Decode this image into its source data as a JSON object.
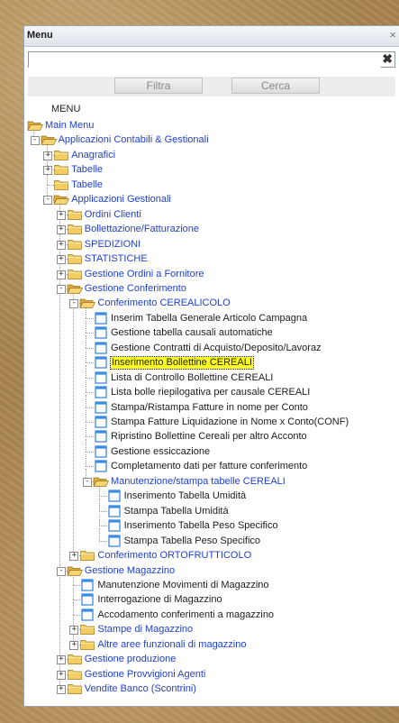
{
  "window": {
    "title": "Menu",
    "close_glyph": "×"
  },
  "search": {
    "value": "",
    "placeholder": "",
    "clear_glyph": "✖"
  },
  "buttons": {
    "filtra": "Filtra",
    "cerca": "Cerca"
  },
  "tree_caption": "MENU",
  "colors": {
    "folder": "#f0c75a",
    "link": "#1f3fd1",
    "highlight": "#ffff1e",
    "leaf_icon": "#3b82d6"
  },
  "tree": [
    {
      "label": "Main Menu",
      "level": 0,
      "icon": "folder-open",
      "exp": "",
      "blue": true
    },
    {
      "label": "Applicazioni Contabili & Gestionali",
      "level": 1,
      "icon": "folder-open",
      "exp": "-",
      "blue": true
    },
    {
      "label": "Anagrafici",
      "level": 2,
      "icon": "folder",
      "exp": "+",
      "blue": true
    },
    {
      "label": "Tabelle",
      "level": 2,
      "icon": "folder",
      "exp": "+",
      "blue": true
    },
    {
      "label": "Tabelle",
      "level": 2,
      "icon": "folder",
      "exp": "",
      "blue": true
    },
    {
      "label": "Applicazioni Gestionali",
      "level": 2,
      "icon": "folder-open",
      "exp": "-",
      "blue": true
    },
    {
      "label": "Ordini Clienti",
      "level": 3,
      "icon": "folder",
      "exp": "+",
      "blue": true
    },
    {
      "label": "Bollettazione/Fatturazione",
      "level": 3,
      "icon": "folder",
      "exp": "+",
      "blue": true
    },
    {
      "label": "SPEDIZIONI",
      "level": 3,
      "icon": "folder",
      "exp": "+",
      "blue": true
    },
    {
      "label": "STATISTICHE",
      "level": 3,
      "icon": "folder",
      "exp": "+",
      "blue": true
    },
    {
      "label": "Gestione Ordini a Fornitore",
      "level": 3,
      "icon": "folder",
      "exp": "+",
      "blue": true
    },
    {
      "label": "Gestione Conferimento",
      "level": 3,
      "icon": "folder-open",
      "exp": "-",
      "blue": true
    },
    {
      "label": "Conferimento CEREALICOLO",
      "level": 4,
      "icon": "folder-open",
      "exp": "-",
      "blue": true
    },
    {
      "label": "Inserim Tabella Generale Articolo Campagna",
      "level": 5,
      "icon": "program",
      "exp": "",
      "blue": false
    },
    {
      "label": "Gestione tabella causali automatiche",
      "level": 5,
      "icon": "program",
      "exp": "",
      "blue": false
    },
    {
      "label": "Gestione Contratti di Acquisto/Deposito/Lavoraz",
      "level": 5,
      "icon": "program",
      "exp": "",
      "blue": false
    },
    {
      "label": "Inserimento Bollettine CEREALI",
      "level": 5,
      "icon": "program",
      "exp": "",
      "blue": false,
      "selected": true
    },
    {
      "label": "Lista di Controllo Bollettine CEREALI",
      "level": 5,
      "icon": "program",
      "exp": "",
      "blue": false
    },
    {
      "label": "Lista bolle riepilogativa per causale CEREALI",
      "level": 5,
      "icon": "program",
      "exp": "",
      "blue": false
    },
    {
      "label": "Stampa/Ristampa Fatture in nome per Conto",
      "level": 5,
      "icon": "program",
      "exp": "",
      "blue": false
    },
    {
      "label": "Stampa Fatture Liquidazione in Nome x Conto(CONF)",
      "level": 5,
      "icon": "program",
      "exp": "",
      "blue": false
    },
    {
      "label": "Ripristino Bollettine Cereali per altro Acconto",
      "level": 5,
      "icon": "program",
      "exp": "",
      "blue": false
    },
    {
      "label": "Gestione essiccazione",
      "level": 5,
      "icon": "program",
      "exp": "",
      "blue": false
    },
    {
      "label": "Completamento dati per fatture conferimento",
      "level": 5,
      "icon": "program",
      "exp": "",
      "blue": false
    },
    {
      "label": "Manutenzione/stampa tabelle CEREALI",
      "level": 5,
      "icon": "folder-open",
      "exp": "-",
      "blue": true
    },
    {
      "label": "Inserimento Tabella Umidità",
      "level": 6,
      "icon": "program",
      "exp": "",
      "blue": false
    },
    {
      "label": "Stampa Tabella Umidità",
      "level": 6,
      "icon": "program",
      "exp": "",
      "blue": false
    },
    {
      "label": "Inserimento Tabella Peso Specifico",
      "level": 6,
      "icon": "program",
      "exp": "",
      "blue": false
    },
    {
      "label": "Stampa Tabella Peso Specifico",
      "level": 6,
      "icon": "program",
      "exp": "",
      "blue": false
    },
    {
      "label": "Conferimento ORTOFRUTTICOLO",
      "level": 4,
      "icon": "folder",
      "exp": "+",
      "blue": true
    },
    {
      "label": "Gestione Magazzino",
      "level": 3,
      "icon": "folder-open",
      "exp": "-",
      "blue": true
    },
    {
      "label": "Manutenzione Movimenti di Magazzino",
      "level": 4,
      "icon": "program",
      "exp": "",
      "blue": false
    },
    {
      "label": "Interrogazione di Magazzino",
      "level": 4,
      "icon": "program",
      "exp": "",
      "blue": false
    },
    {
      "label": "Accodamento conferimenti a magazzino",
      "level": 4,
      "icon": "program",
      "exp": "",
      "blue": false
    },
    {
      "label": "Stampe di Magazzino",
      "level": 4,
      "icon": "folder",
      "exp": "+",
      "blue": true
    },
    {
      "label": "Altre aree funzionali di magazzino",
      "level": 4,
      "icon": "folder",
      "exp": "+",
      "blue": true
    },
    {
      "label": "Gestione produzione",
      "level": 3,
      "icon": "folder",
      "exp": "+",
      "blue": true
    },
    {
      "label": "Gestione Provvigioni Agenti",
      "level": 3,
      "icon": "folder",
      "exp": "+",
      "blue": true
    },
    {
      "label": "Vendite Banco (Scontrini)",
      "level": 3,
      "icon": "folder",
      "exp": "+",
      "blue": true
    }
  ]
}
